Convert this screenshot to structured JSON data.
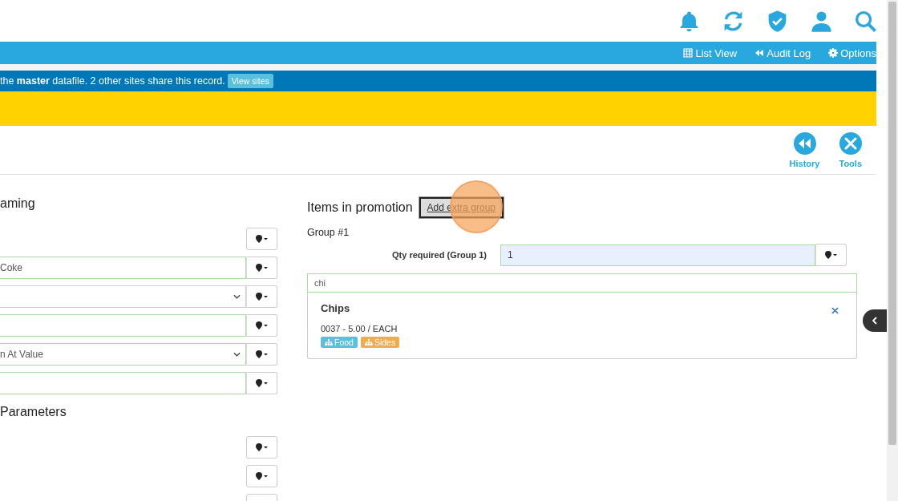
{
  "nav": [
    {
      "label": "List View",
      "kind": "table"
    },
    {
      "label": "Audit Log",
      "kind": "rewind"
    },
    {
      "label": "Options",
      "kind": "gear"
    }
  ],
  "banner": {
    "text": "the **master** datafile. 2 other sites share this record.",
    "button": "View sites"
  },
  "toolbar": [
    {
      "label": "History",
      "kind": "history"
    },
    {
      "label": "Tools",
      "kind": "tools"
    }
  ],
  "left_sections": [
    {
      "title": "aming",
      "rows": [
        {
          "kind": "button_only"
        },
        {
          "kind": "input",
          "value": "Coke"
        },
        {
          "kind": "select"
        },
        {
          "kind": "input"
        },
        {
          "kind": "select",
          "value": "n At Value"
        },
        {
          "kind": "input"
        }
      ]
    },
    {
      "title": "Parameters",
      "rows": [
        {
          "kind": "button_only"
        },
        {
          "kind": "button_only"
        },
        {
          "kind": "button_only"
        }
      ]
    }
  ],
  "promotion": {
    "title": "Items in promotion",
    "add_button": "Add extra group",
    "group_title": "Group #1",
    "qty_label": "Qty required (Group 1)",
    "qty_value": "1",
    "search_value": "chi",
    "results": [
      {
        "name": "Chips",
        "detail": "0037 - 5.00 / EACH",
        "tags": [
          {
            "label": "Food",
            "color": "#5bc0de"
          },
          {
            "label": "Sides",
            "color": "#f0ad4e"
          }
        ]
      }
    ]
  }
}
